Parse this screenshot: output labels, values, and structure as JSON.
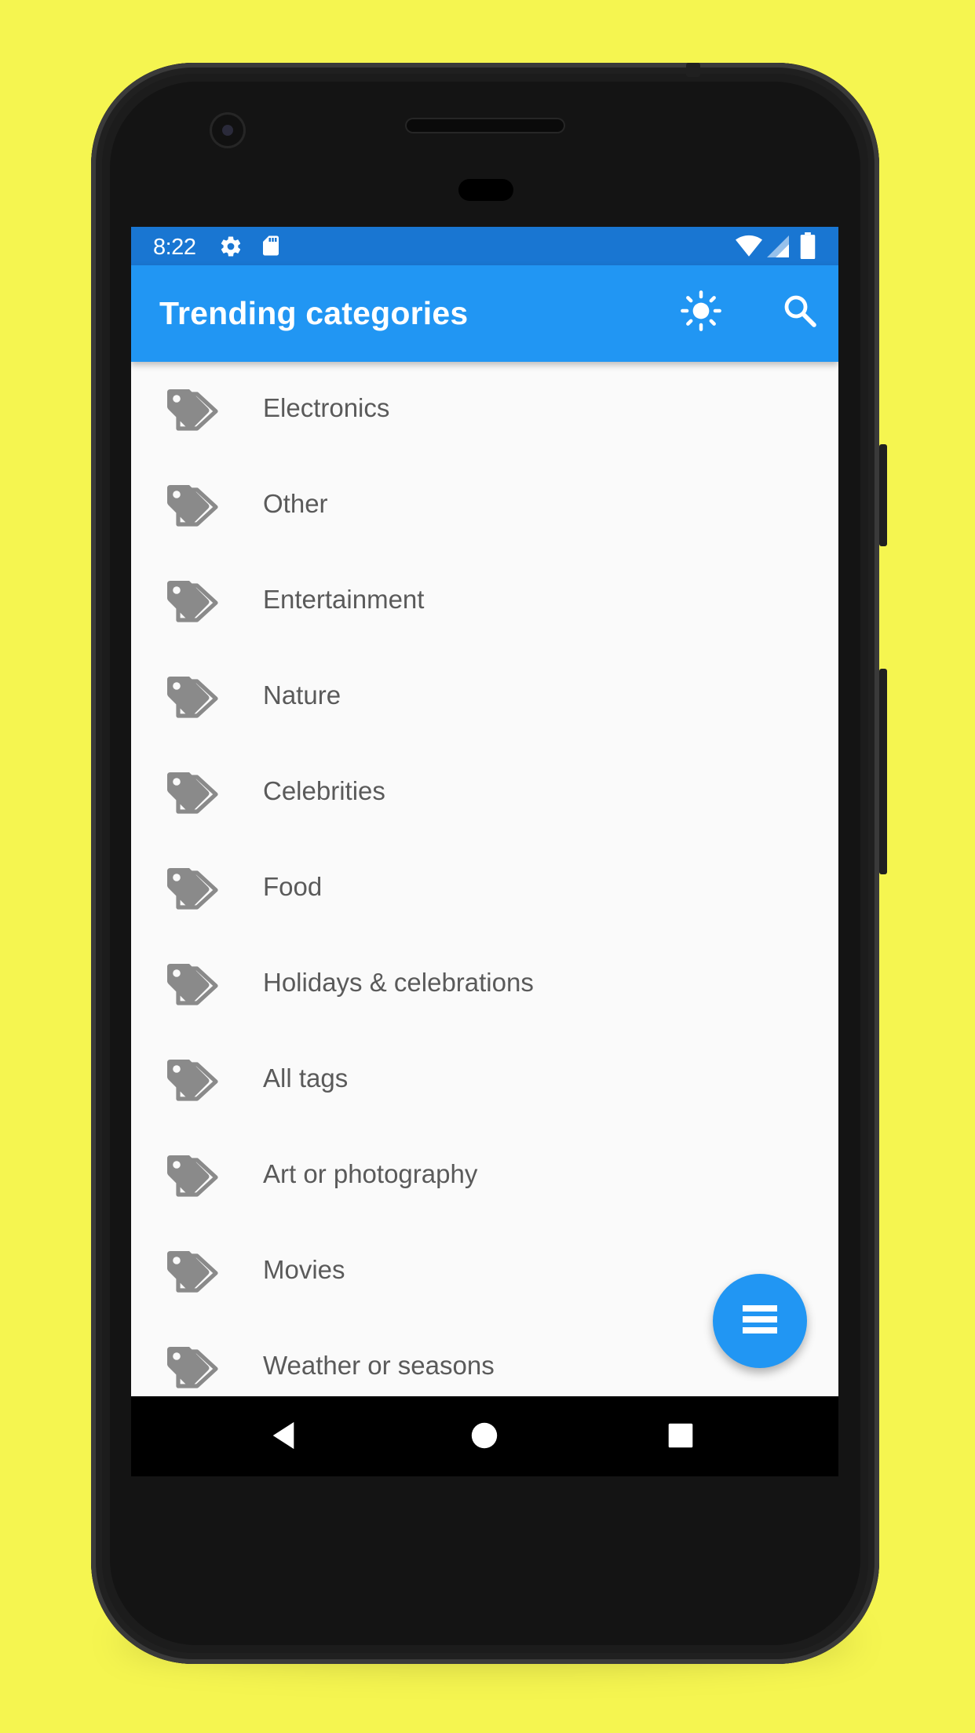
{
  "status_bar": {
    "time": "8:22",
    "left_icons": [
      "gear-icon",
      "sd-card-icon"
    ],
    "right_icons": [
      "wifi-icon",
      "cell-signal-icon",
      "battery-icon"
    ]
  },
  "app_bar": {
    "title": "Trending categories",
    "actions": [
      "brightness-icon",
      "search-icon"
    ]
  },
  "categories": [
    {
      "label": "Electronics",
      "icon": "tag-icon"
    },
    {
      "label": "Other",
      "icon": "tag-icon"
    },
    {
      "label": "Entertainment",
      "icon": "tag-icon"
    },
    {
      "label": "Nature",
      "icon": "tag-icon"
    },
    {
      "label": "Celebrities",
      "icon": "tag-icon"
    },
    {
      "label": "Food",
      "icon": "tag-icon"
    },
    {
      "label": "Holidays & celebrations",
      "icon": "tag-icon"
    },
    {
      "label": "All tags",
      "icon": "tag-icon"
    },
    {
      "label": "Art or photography",
      "icon": "tag-icon"
    },
    {
      "label": "Movies",
      "icon": "tag-icon"
    },
    {
      "label": "Weather or seasons",
      "icon": "tag-icon"
    }
  ],
  "fab": {
    "icon": "view-list-icon"
  },
  "nav_bar": {
    "buttons": [
      "back-icon",
      "home-icon",
      "recents-icon"
    ]
  },
  "colors": {
    "background": "#f5f550",
    "status_bar": "#1976d2",
    "app_bar": "#2196f3",
    "fab": "#2196f3",
    "list_background": "#fafafa",
    "item_text": "#5a5a5a",
    "tag_icon": "#8a8a8a"
  }
}
